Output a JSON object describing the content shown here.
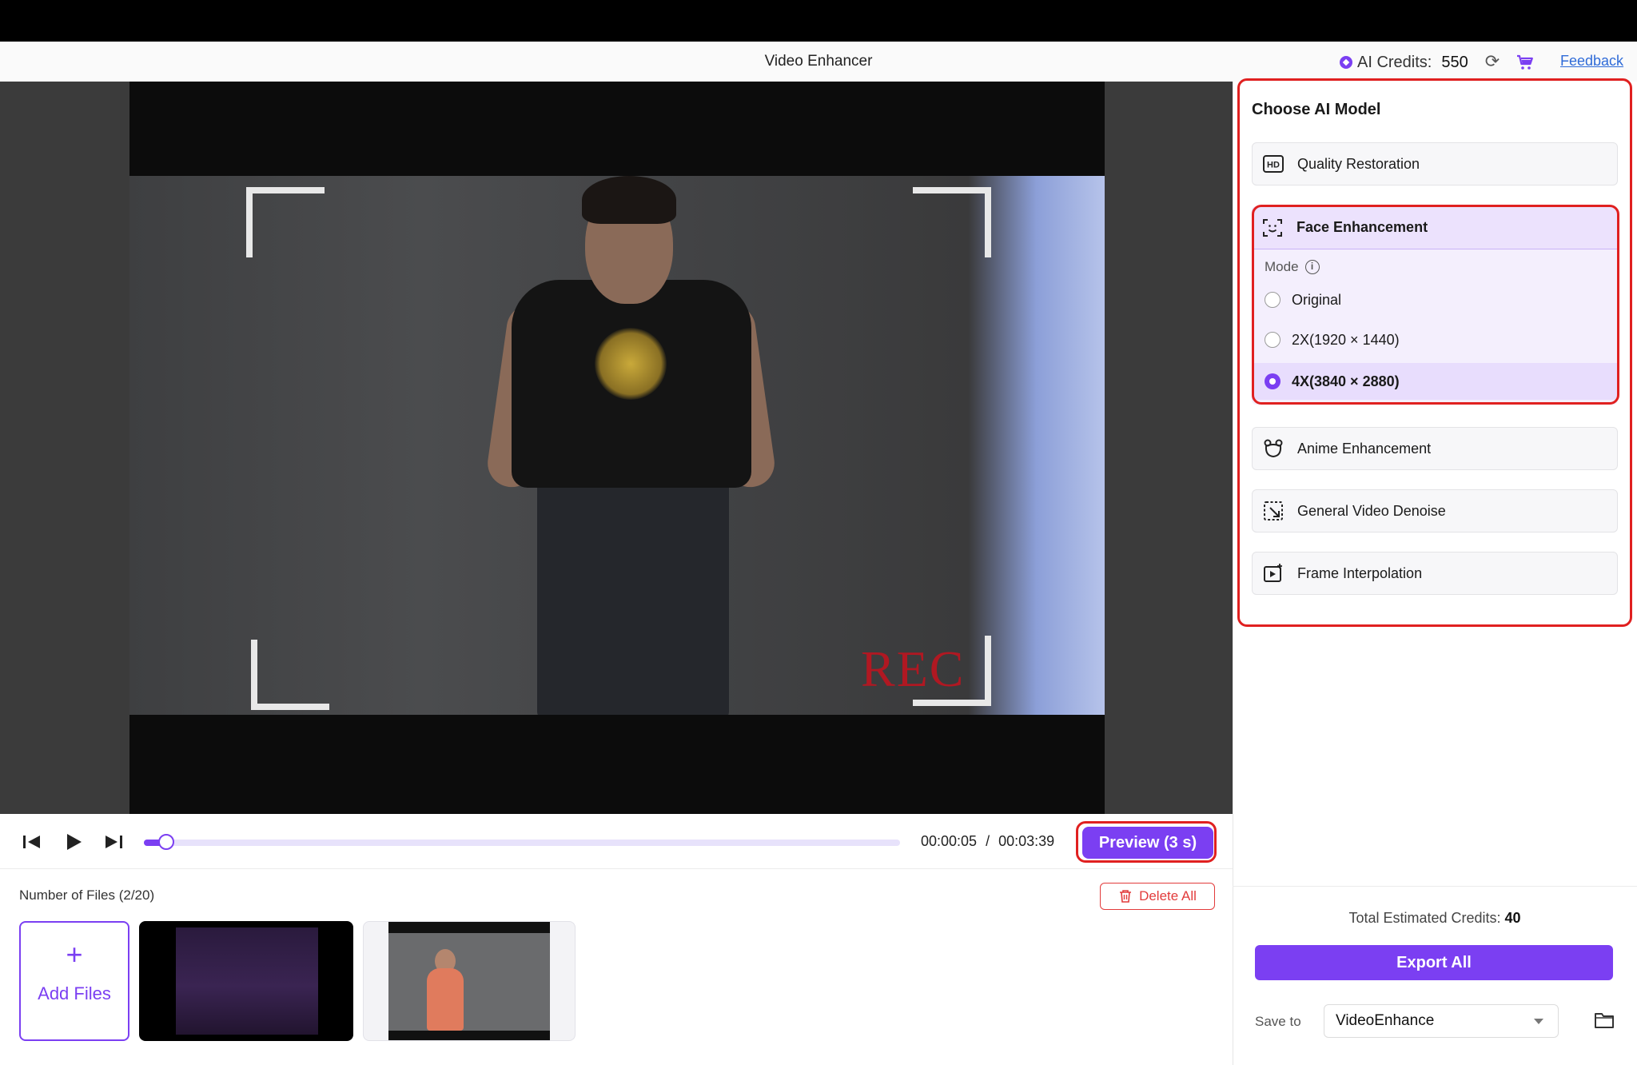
{
  "header": {
    "title": "Video Enhancer",
    "credits_label": "AI Credits:",
    "credits_value": "550",
    "feedback": "Feedback"
  },
  "player": {
    "time_current": "00:00:05",
    "time_separator": "/",
    "time_total": "00:03:39",
    "progress": 0.03,
    "preview_label": "Preview (3 s)",
    "overlay_text": "REC"
  },
  "files": {
    "count_label": "Number of Files (2/20)",
    "delete_label": "Delete All",
    "add_label": "Add Files",
    "add_symbol": "+"
  },
  "sidebar": {
    "title": "Choose AI Model",
    "models": [
      {
        "label": "Quality Restoration",
        "icon": "hd-icon"
      },
      {
        "label": "Face Enhancement",
        "icon": "face-scan-icon",
        "selected": true
      },
      {
        "label": "Anime Enhancement",
        "icon": "anime-bear-icon"
      },
      {
        "label": "General Video Denoise",
        "icon": "denoise-icon"
      },
      {
        "label": "Frame Interpolation",
        "icon": "frame-interpolation-icon"
      }
    ],
    "mode_label": "Mode",
    "modes": [
      {
        "label": "Original",
        "selected": false
      },
      {
        "label": "2X(1920 × 1440)",
        "selected": false
      },
      {
        "label": "4X(3840 × 2880)",
        "selected": true
      }
    ],
    "estimated_label": "Total Estimated Credits:",
    "estimated_value": "40",
    "export_label": "Export All",
    "save_to_label": "Save to",
    "save_to_value": "VideoEnhance"
  },
  "colors": {
    "accent": "#7b3ff2",
    "highlight": "#e02020",
    "danger": "#e23b3b"
  }
}
